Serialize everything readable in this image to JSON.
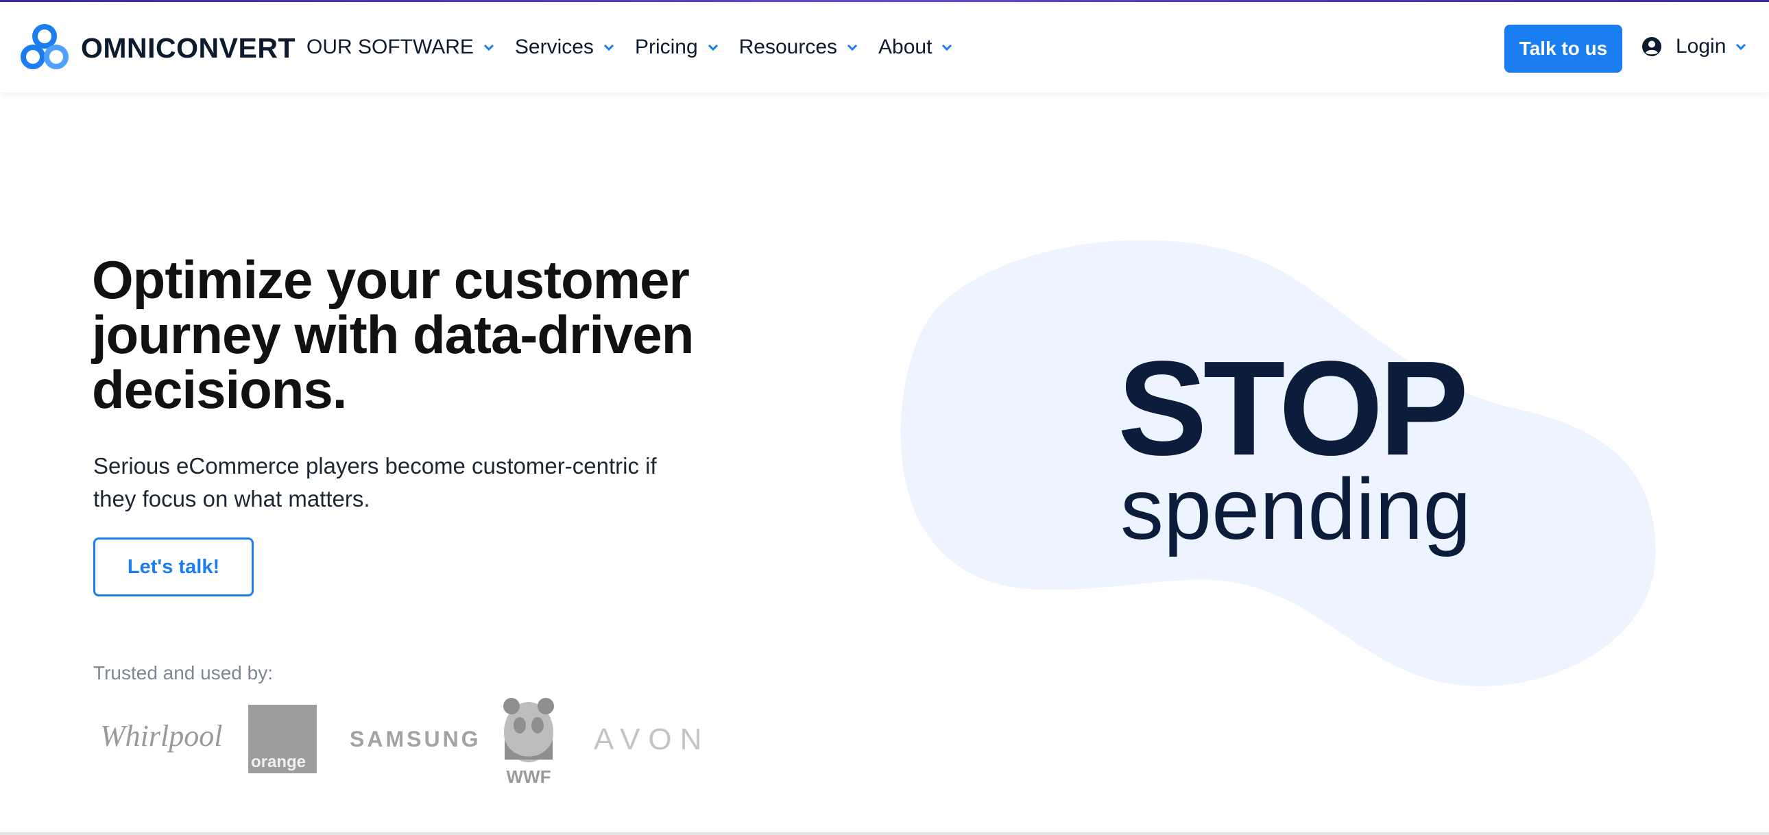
{
  "brand": {
    "name": "OMNICONVERT"
  },
  "nav": {
    "items": [
      {
        "label": "OUR SOFTWARE"
      },
      {
        "label": "Services"
      },
      {
        "label": "Pricing"
      },
      {
        "label": "Resources"
      },
      {
        "label": "About"
      }
    ],
    "cta_label": "Talk to us",
    "login_label": "Login"
  },
  "hero": {
    "title": "Optimize your customer journey with data-driven decisions.",
    "subtitle": "Serious eCommerce players become customer-centric if they focus on what matters.",
    "button_label": "Let's talk!",
    "trusted_label": "Trusted and used by:",
    "logos": {
      "whirlpool": "Whirlpool",
      "orange": "orange",
      "samsung": "SAMSUNG",
      "wwf": "WWF",
      "avon": "AVON"
    },
    "visual": {
      "line1": "STOP",
      "line2": "spending"
    }
  },
  "colors": {
    "accent": "#1a7df0",
    "blob": "#edf4ff",
    "dark": "#0b1d3a"
  },
  "icons": {
    "logo": "three-circles-logo-icon",
    "chevron": "chevron-down-icon",
    "user": "user-circle-icon"
  }
}
